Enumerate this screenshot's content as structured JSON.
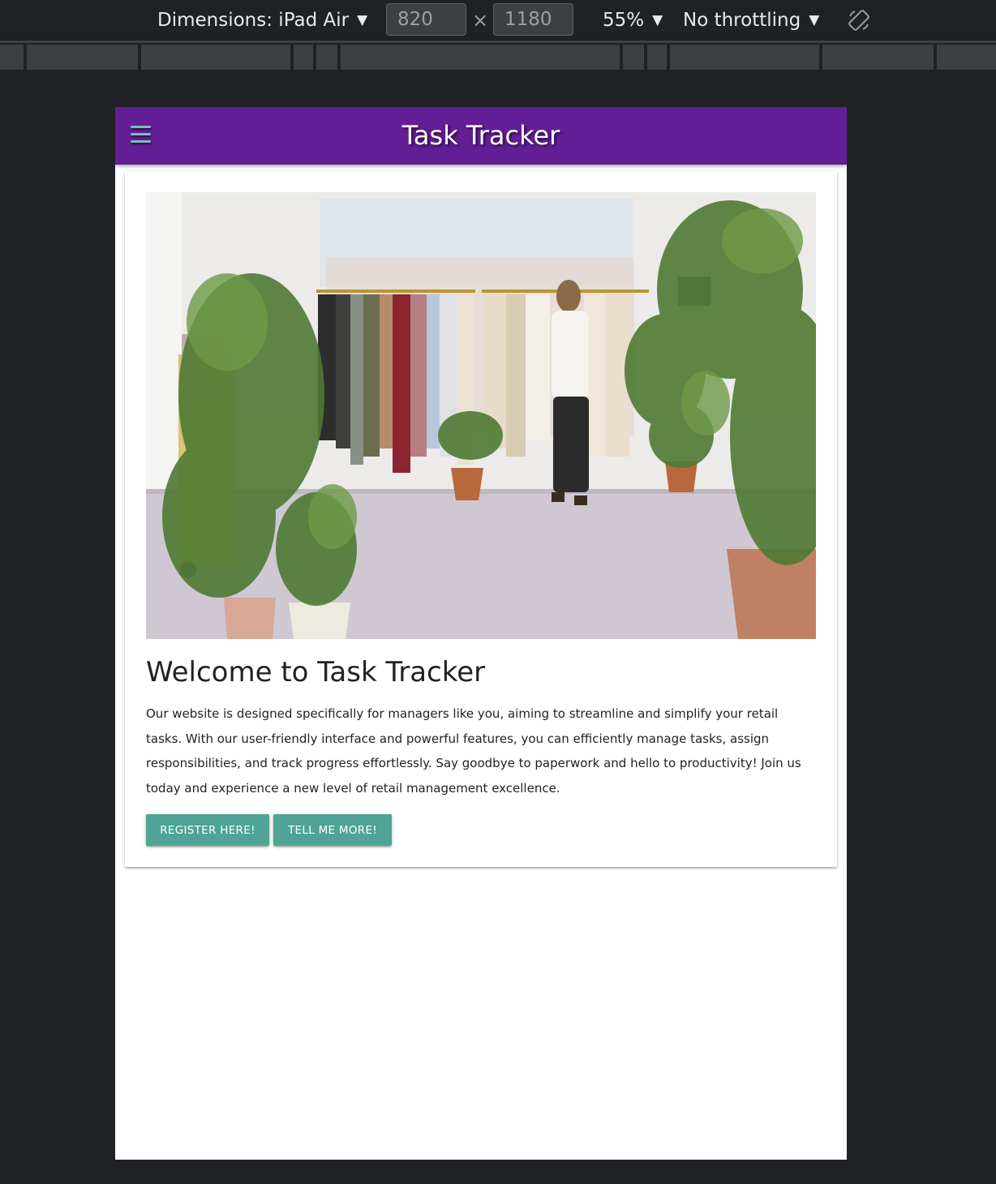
{
  "devtools": {
    "dimensions_label": "Dimensions: iPad Air",
    "width_value": "820",
    "height_value": "1180",
    "times_symbol": "×",
    "zoom": "55%",
    "throttling": "No throttling",
    "caret": "▼",
    "icons": [
      "dropdown-caret-icon",
      "rotate-device-icon"
    ]
  },
  "navbar": {
    "menu_icon": "hamburger-menu-icon",
    "brand": "Task Tracker",
    "background": "#631e96"
  },
  "hero": {
    "title": "Welcome to Task Tracker",
    "description": "Our website is designed specifically for managers like you, aiming to streamline and simplify your retail tasks. With our user-friendly interface and powerful features, you can efficiently manage tasks, assign responsibilities, and track progress effortlessly. Say goodbye to paperwork and hello to productivity! Join us today and experience a new level of retail management excellence.",
    "register_label": "Register here!",
    "more_label": "Tell me more!",
    "button_color": "#4fa397"
  }
}
